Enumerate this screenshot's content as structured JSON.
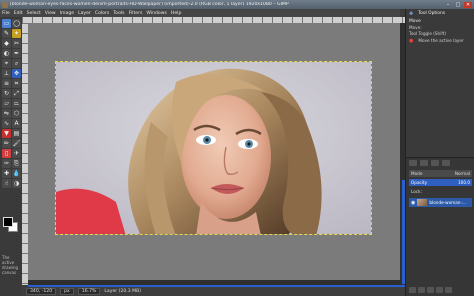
{
  "window": {
    "title": "[blonde-woman-eyes-faces-women-denim-portraits-HD-Wallpaper] (imported)-2.0 (RGB color, 1 layer) 1920x1080 – GIMP",
    "controls": {
      "minimize": "–",
      "maximize": "□",
      "close": "✕"
    }
  },
  "menu": [
    "File",
    "Edit",
    "Select",
    "View",
    "Image",
    "Layer",
    "Colors",
    "Tools",
    "Filters",
    "Windows",
    "Help"
  ],
  "toolbox": {
    "tools": [
      {
        "icon": "rect-select-icon",
        "glyph": "▭",
        "color": "#4a7fd4"
      },
      {
        "icon": "ellipse-select-icon",
        "glyph": "◯",
        "color": "#4a4a4a"
      },
      {
        "icon": "free-select-icon",
        "glyph": "✎",
        "color": "#4a4a4a"
      },
      {
        "icon": "fuzzy-select-icon",
        "glyph": "✦",
        "color": "#c8a020"
      },
      {
        "icon": "color-select-icon",
        "glyph": "◆",
        "color": "#4a4a4a"
      },
      {
        "icon": "scissors-icon",
        "glyph": "✂",
        "color": "#4a4a4a"
      },
      {
        "icon": "foreground-select-icon",
        "glyph": "◐",
        "color": "#4a4a4a"
      },
      {
        "icon": "paths-icon",
        "glyph": "✒",
        "color": "#4a4a4a"
      },
      {
        "icon": "color-picker-icon",
        "glyph": "⌖",
        "color": "#4a4a4a"
      },
      {
        "icon": "zoom-icon",
        "glyph": "⌕",
        "color": "#4a4a4a"
      },
      {
        "icon": "measure-icon",
        "glyph": "⟂",
        "color": "#4a4a4a"
      },
      {
        "icon": "move-icon",
        "glyph": "✥",
        "color": "#2f5fbf"
      },
      {
        "icon": "align-icon",
        "glyph": "≡",
        "color": "#4a4a4a"
      },
      {
        "icon": "crop-icon",
        "glyph": "⌗",
        "color": "#4a4a4a"
      },
      {
        "icon": "rotate-icon",
        "glyph": "↻",
        "color": "#4a4a4a"
      },
      {
        "icon": "scale-icon",
        "glyph": "⤢",
        "color": "#4a4a4a"
      },
      {
        "icon": "shear-icon",
        "glyph": "▱",
        "color": "#4a4a4a"
      },
      {
        "icon": "perspective-icon",
        "glyph": "⏢",
        "color": "#4a4a4a"
      },
      {
        "icon": "flip-icon",
        "glyph": "⇋",
        "color": "#4a4a4a"
      },
      {
        "icon": "cage-icon",
        "glyph": "⬡",
        "color": "#4a4a4a"
      },
      {
        "icon": "warp-icon",
        "glyph": "∿",
        "color": "#4a4a4a"
      },
      {
        "icon": "text-icon",
        "glyph": "A",
        "color": "#4a4a4a"
      },
      {
        "icon": "bucket-fill-icon",
        "glyph": "▼",
        "color": "#c83030"
      },
      {
        "icon": "gradient-icon",
        "glyph": "▤",
        "color": "#4a4a4a"
      },
      {
        "icon": "pencil-icon",
        "glyph": "✏",
        "color": "#4a4a4a"
      },
      {
        "icon": "paintbrush-icon",
        "glyph": "🖌",
        "color": "#4a4a4a"
      },
      {
        "icon": "eraser-icon",
        "glyph": "▯",
        "color": "#d04040"
      },
      {
        "icon": "airbrush-icon",
        "glyph": "✈",
        "color": "#4a4a4a"
      },
      {
        "icon": "ink-icon",
        "glyph": "✑",
        "color": "#4a4a4a"
      },
      {
        "icon": "clone-icon",
        "glyph": "⎘",
        "color": "#4a4a4a"
      },
      {
        "icon": "heal-icon",
        "glyph": "✚",
        "color": "#4a4a4a"
      },
      {
        "icon": "blur-icon",
        "glyph": "💧",
        "color": "#4a4a4a"
      },
      {
        "icon": "smudge-icon",
        "glyph": "☝",
        "color": "#4a4a4a"
      },
      {
        "icon": "dodge-burn-icon",
        "glyph": "◑",
        "color": "#4a4a4a"
      }
    ],
    "hint": "The active drawing canvas"
  },
  "statusbar": {
    "coords": "340, -120",
    "unit": "px",
    "zoom": "16.7%",
    "layer_info": "Layer (20.3 MB)"
  },
  "dock": {
    "header": "Tool Options",
    "section": "Move",
    "move_label": "Move:",
    "toggle_label": "Tool Toggle (Shift)",
    "option_label": "Move the active layer"
  },
  "layers": {
    "mode_label": "Mode",
    "mode_value": "Normal",
    "opacity_label": "Opacity",
    "opacity_value": "100.0",
    "lock_label": "Lock:",
    "layer_name": "blonde-woman-..."
  }
}
